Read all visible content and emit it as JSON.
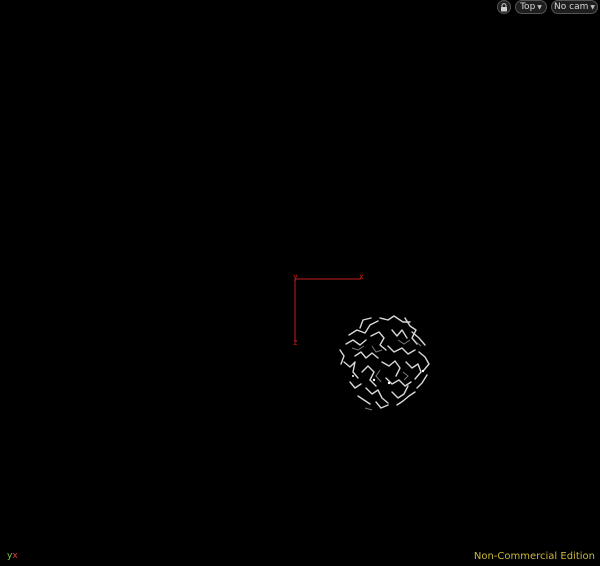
{
  "toolbar": {
    "lock_icon": "lock-icon",
    "view_label": "Top",
    "camera_label": "No cam"
  },
  "scene": {
    "grid_axes": {
      "y_label": "y",
      "x_label": "x",
      "z_label": "z"
    }
  },
  "corner_axes": {
    "y_label": "y",
    "x_label": "x"
  },
  "watermark": "Non-Commercial Edition",
  "colors": {
    "background": "#000000",
    "axis_red": "#c81e1e",
    "geometry": "#d8d8d8",
    "watermark": "#c9b53a"
  }
}
